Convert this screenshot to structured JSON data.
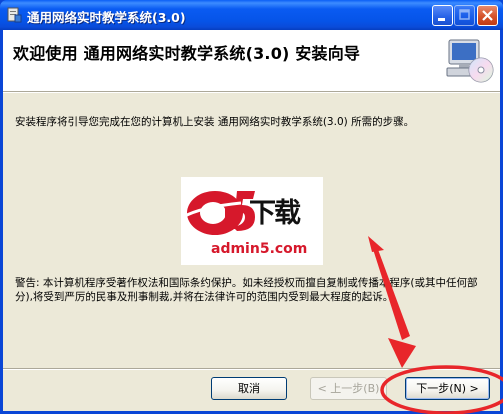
{
  "window": {
    "title": "通用网络实时教学系统(3.0)"
  },
  "header": {
    "title": "欢迎使用 通用网络实时教学系统(3.0) 安装向导"
  },
  "body": {
    "description": "安装程序将引导您完成在您的计算机上安装 通用网络实时教学系统(3.0) 所需的步骤。",
    "warning": "警告: 本计算机程序受著作权法和国际条约保护。如未经授权而擅自复制或传播本程序(或其中任何部分),将受到严厉的民事及刑事制裁,并将在法律许可的范围内受到最大程度的起诉。"
  },
  "watermark": {
    "mark": "a5",
    "text_cn": "下载",
    "url": "admin5.com"
  },
  "buttons": {
    "cancel": "取消",
    "back": "< 上一步(B)",
    "next": "下一步(N) >"
  },
  "colors": {
    "titlebar": "#0a5bf2",
    "dialog_bg": "#ece9d8",
    "annotation": "#e8262a",
    "logo_red": "#d6182b"
  }
}
